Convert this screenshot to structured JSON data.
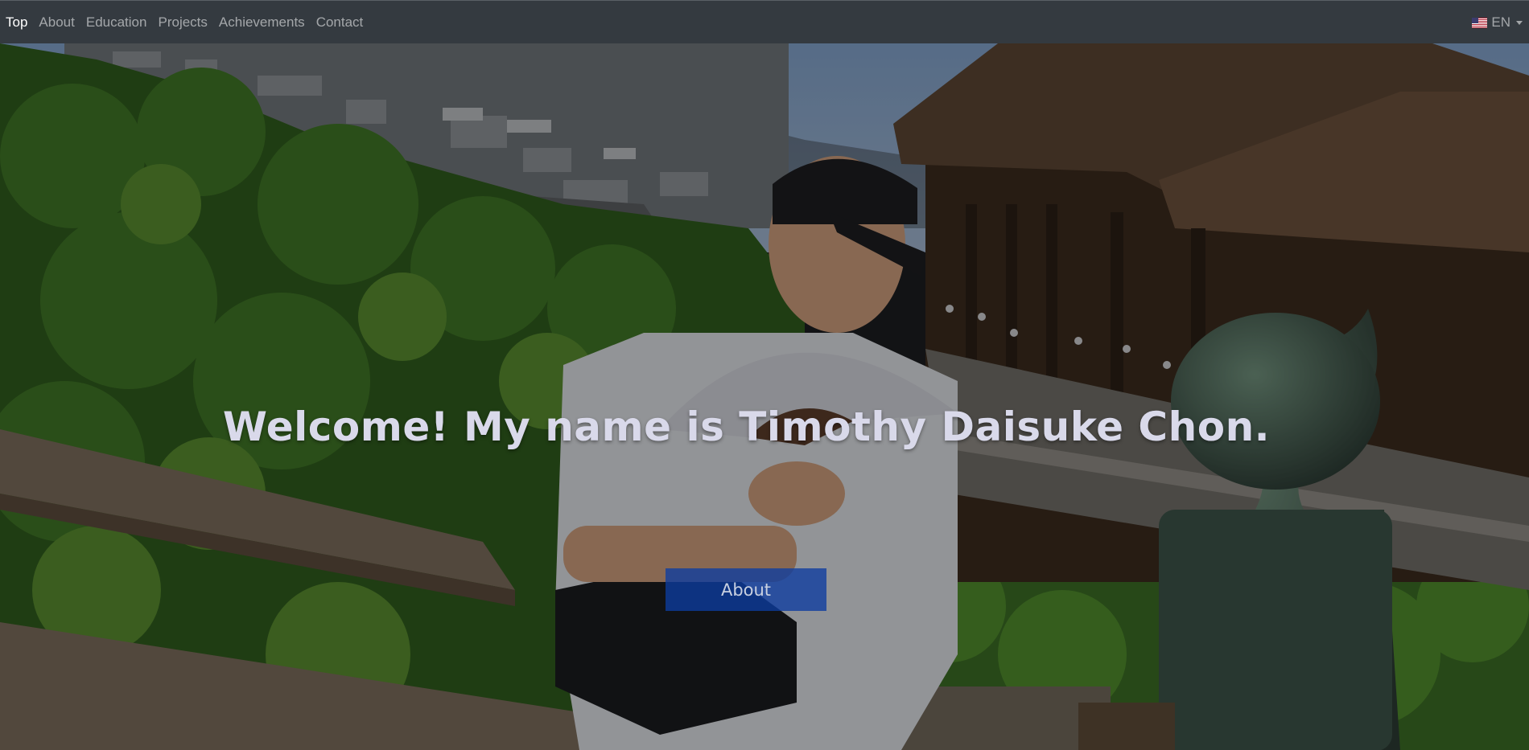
{
  "nav": {
    "items": [
      {
        "label": "Top",
        "active": true
      },
      {
        "label": "About",
        "active": false
      },
      {
        "label": "Education",
        "active": false
      },
      {
        "label": "Projects",
        "active": false
      },
      {
        "label": "Achievements",
        "active": false
      },
      {
        "label": "Contact",
        "active": false
      }
    ],
    "language": {
      "label": "EN",
      "flag_icon": "us-flag-icon"
    }
  },
  "hero": {
    "headline": "Welcome! My name is Timothy Daisuke Chon.",
    "button_label": "About",
    "colors": {
      "button": "#0d3ca0",
      "headline": "#d9d9ea",
      "navbar": "#343a40"
    }
  }
}
